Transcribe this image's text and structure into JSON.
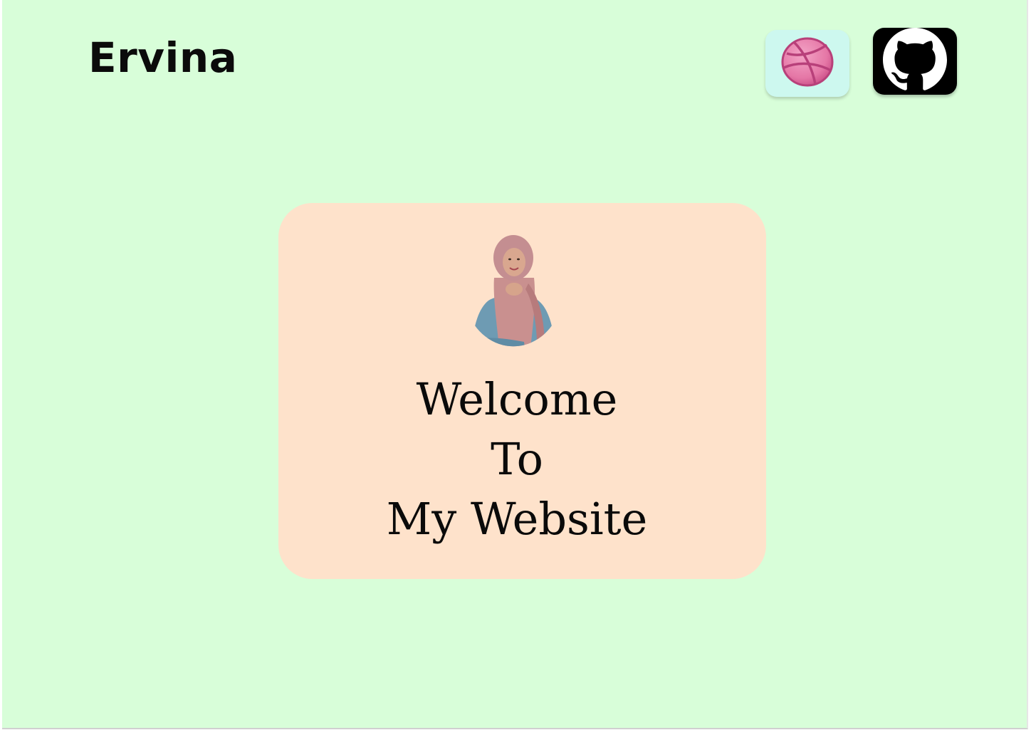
{
  "header": {
    "brand": "Ervina",
    "social": [
      {
        "name": "dribbble",
        "icon": "dribbble-icon",
        "bg": "#cdf8ef",
        "color": "#e16d9f"
      },
      {
        "name": "github",
        "icon": "github-icon",
        "bg": "#000000",
        "color": "#ffffff"
      }
    ]
  },
  "hero": {
    "avatar_alt": "avatar",
    "lines": [
      "Welcome",
      "To",
      "My Website"
    ]
  },
  "colors": {
    "page_background": "#d8fed9",
    "card_background": "#fee2cb",
    "text": "#0a0a0a"
  }
}
